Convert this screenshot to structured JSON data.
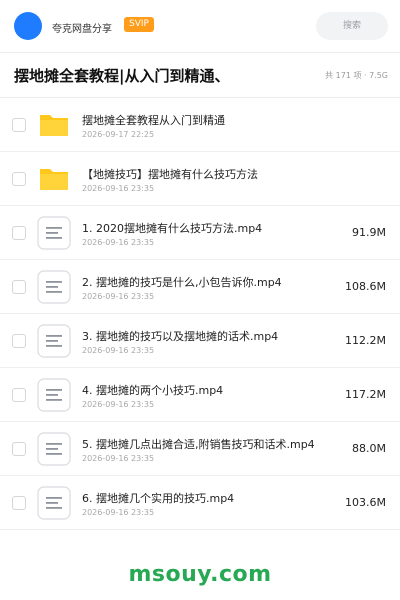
{
  "header": {
    "brand_name": "夸克网盘分享",
    "badge": "SVIP",
    "search_placeholder": "搜索"
  },
  "title_row": {
    "title": "摆地摊全套教程|从入门到精通、",
    "meta": "共 171 项 · 7.5G"
  },
  "colors": {
    "accent_blue": "#1f7cff",
    "svip_orange": "#ff9c1a",
    "folder_yellow": "#ffcc1a",
    "watermark_green": "#27a852"
  },
  "items": [
    {
      "type": "folder",
      "icon": "folder-icon",
      "name": "摆地摊全套教程从入门到精通",
      "date": "2026-09-17 22:25",
      "size": ""
    },
    {
      "type": "folder",
      "icon": "folder-icon",
      "name": "【地摊技巧】摆地摊有什么技巧方法",
      "date": "2026-09-16 23:35",
      "size": ""
    },
    {
      "type": "file",
      "icon": "document-icon",
      "name": "1. 2020摆地摊有什么技巧方法.mp4",
      "date": "2026-09-16 23:35",
      "size": "91.9M"
    },
    {
      "type": "file",
      "icon": "document-icon",
      "name": "2. 摆地摊的技巧是什么,小包告诉你.mp4",
      "date": "2026-09-16 23:35",
      "size": "108.6M"
    },
    {
      "type": "file",
      "icon": "document-icon",
      "name": "3. 摆地摊的技巧以及摆地摊的话术.mp4",
      "date": "2026-09-16 23:35",
      "size": "112.2M"
    },
    {
      "type": "file",
      "icon": "document-icon",
      "name": "4. 摆地摊的两个小技巧.mp4",
      "date": "2026-09-16 23:35",
      "size": "117.2M"
    },
    {
      "type": "file",
      "icon": "document-icon",
      "name": "5. 摆地摊几点出摊合适,附销售技巧和话术.mp4",
      "date": "2026-09-16 23:35",
      "size": "88.0M"
    },
    {
      "type": "file",
      "icon": "document-icon",
      "name": "6. 摆地摊几个实用的技巧.mp4",
      "date": "2026-09-16 23:35",
      "size": "103.6M"
    }
  ],
  "watermark": "msouy.com"
}
